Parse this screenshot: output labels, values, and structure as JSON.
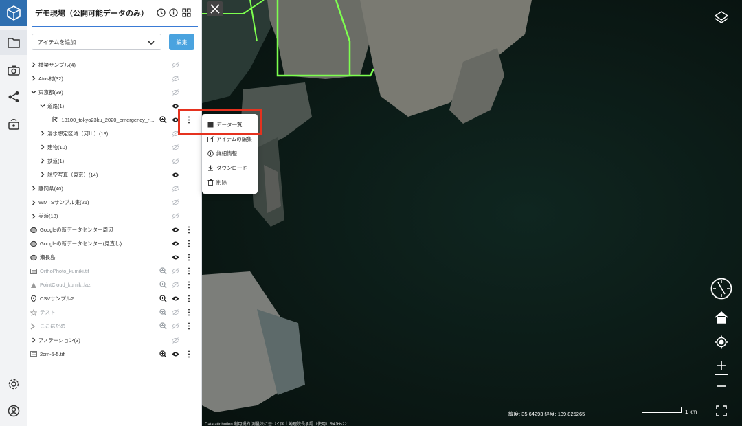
{
  "panel": {
    "title": "デモ現場（公開可能データのみ）",
    "add_item_placeholder": "アイテムを追加",
    "edit_label": "編集"
  },
  "tree": [
    {
      "label": "橋梁サンプル(4)",
      "indent": 0,
      "kind": "folder",
      "open": false,
      "zoom": false,
      "eye": "off",
      "more": false,
      "dim": false
    },
    {
      "label": "Atos村(32)",
      "indent": 0,
      "kind": "folder",
      "open": false,
      "zoom": false,
      "eye": "off",
      "more": false,
      "dim": false
    },
    {
      "label": "東京都(39)",
      "indent": 0,
      "kind": "folder",
      "open": true,
      "zoom": false,
      "eye": "off",
      "more": false,
      "dim": false
    },
    {
      "label": "道路(1)",
      "indent": 1,
      "kind": "folder",
      "open": true,
      "zoom": false,
      "eye": "on",
      "more": false,
      "dim": false
    },
    {
      "label": "13100_tokyo23ku_2020_emergency_route.j...",
      "indent": 2,
      "kind": "route",
      "open": null,
      "zoom": true,
      "eye": "on",
      "more": true,
      "dim": false
    },
    {
      "label": "浸水想定区域（河川）(13)",
      "indent": 1,
      "kind": "folder",
      "open": false,
      "zoom": false,
      "eye": "off",
      "more": false,
      "dim": false
    },
    {
      "label": "建物(10)",
      "indent": 1,
      "kind": "folder",
      "open": false,
      "zoom": false,
      "eye": "off",
      "more": false,
      "dim": false
    },
    {
      "label": "鉄道(1)",
      "indent": 1,
      "kind": "folder",
      "open": false,
      "zoom": false,
      "eye": "off",
      "more": false,
      "dim": false
    },
    {
      "label": "航空写真（東京）(14)",
      "indent": 1,
      "kind": "folder",
      "open": false,
      "zoom": false,
      "eye": "on",
      "more": false,
      "dim": false
    },
    {
      "label": "静岡県(40)",
      "indent": 0,
      "kind": "folder",
      "open": false,
      "zoom": false,
      "eye": "off",
      "more": false,
      "dim": false
    },
    {
      "label": "WMTSサンプル集(21)",
      "indent": 0,
      "kind": "folder",
      "open": false,
      "zoom": false,
      "eye": "off",
      "more": false,
      "dim": false
    },
    {
      "label": "美浜(18)",
      "indent": 0,
      "kind": "folder",
      "open": false,
      "zoom": false,
      "eye": "off",
      "more": false,
      "dim": false
    },
    {
      "label": "Googleの新データセンター周辺",
      "indent": 0,
      "kind": "tiles3d",
      "open": null,
      "zoom": false,
      "eye": "on",
      "more": true,
      "dim": false
    },
    {
      "label": "Googleの新データセンター(見直し)",
      "indent": 0,
      "kind": "tiles3d",
      "open": null,
      "zoom": false,
      "eye": "on",
      "more": true,
      "dim": false
    },
    {
      "label": "瀬長島",
      "indent": 0,
      "kind": "tiles3d",
      "open": null,
      "zoom": false,
      "eye": "on",
      "more": true,
      "dim": false
    },
    {
      "label": "OrthoPhoto_kumiki.tif",
      "indent": 0,
      "kind": "image",
      "open": null,
      "zoom": true,
      "eye": "off",
      "more": true,
      "dim": true
    },
    {
      "label": "PointCloud_kumiki.laz",
      "indent": 0,
      "kind": "pointcloud",
      "open": null,
      "zoom": true,
      "eye": "off",
      "more": true,
      "dim": true
    },
    {
      "label": "CSVサンプル2",
      "indent": 0,
      "kind": "pin",
      "open": null,
      "zoom": true,
      "eye": "on",
      "more": true,
      "dim": false
    },
    {
      "label": "テスト",
      "indent": 0,
      "kind": "star",
      "open": null,
      "zoom": true,
      "eye": "off",
      "more": true,
      "dim": true
    },
    {
      "label": "ここはだめ",
      "indent": 0,
      "kind": "line",
      "open": null,
      "zoom": true,
      "eye": "off",
      "more": true,
      "dim": true
    },
    {
      "label": "アノテーション(3)",
      "indent": 0,
      "kind": "folder",
      "open": false,
      "zoom": false,
      "eye": "off",
      "more": false,
      "dim": false
    },
    {
      "label": "2cm-5-5.tiff",
      "indent": 0,
      "kind": "image",
      "open": null,
      "zoom": true,
      "eye": "on",
      "more": true,
      "dim": false
    }
  ],
  "context_menu": {
    "items": [
      {
        "label": "データ一覧",
        "icon": "table-icon"
      },
      {
        "label": "アイテムの編集",
        "icon": "edit-icon"
      },
      {
        "label": "詳細情報",
        "icon": "info-icon"
      },
      {
        "label": "ダウンロード",
        "icon": "download-icon"
      },
      {
        "label": "削除",
        "icon": "trash-icon"
      }
    ]
  },
  "map": {
    "coordinates": "緯度: 35.64293  経度: 139.825265",
    "scale_label": "1 km",
    "attribution": "Data attribution  利用規約  測量法に基づく国土地理院長承認（使用）R4JHs221"
  },
  "colors": {
    "accent": "#4aa3df",
    "highlight": "#e5321f",
    "logo_bg": "#2f6fb0",
    "road_line": "#7dff4f"
  }
}
